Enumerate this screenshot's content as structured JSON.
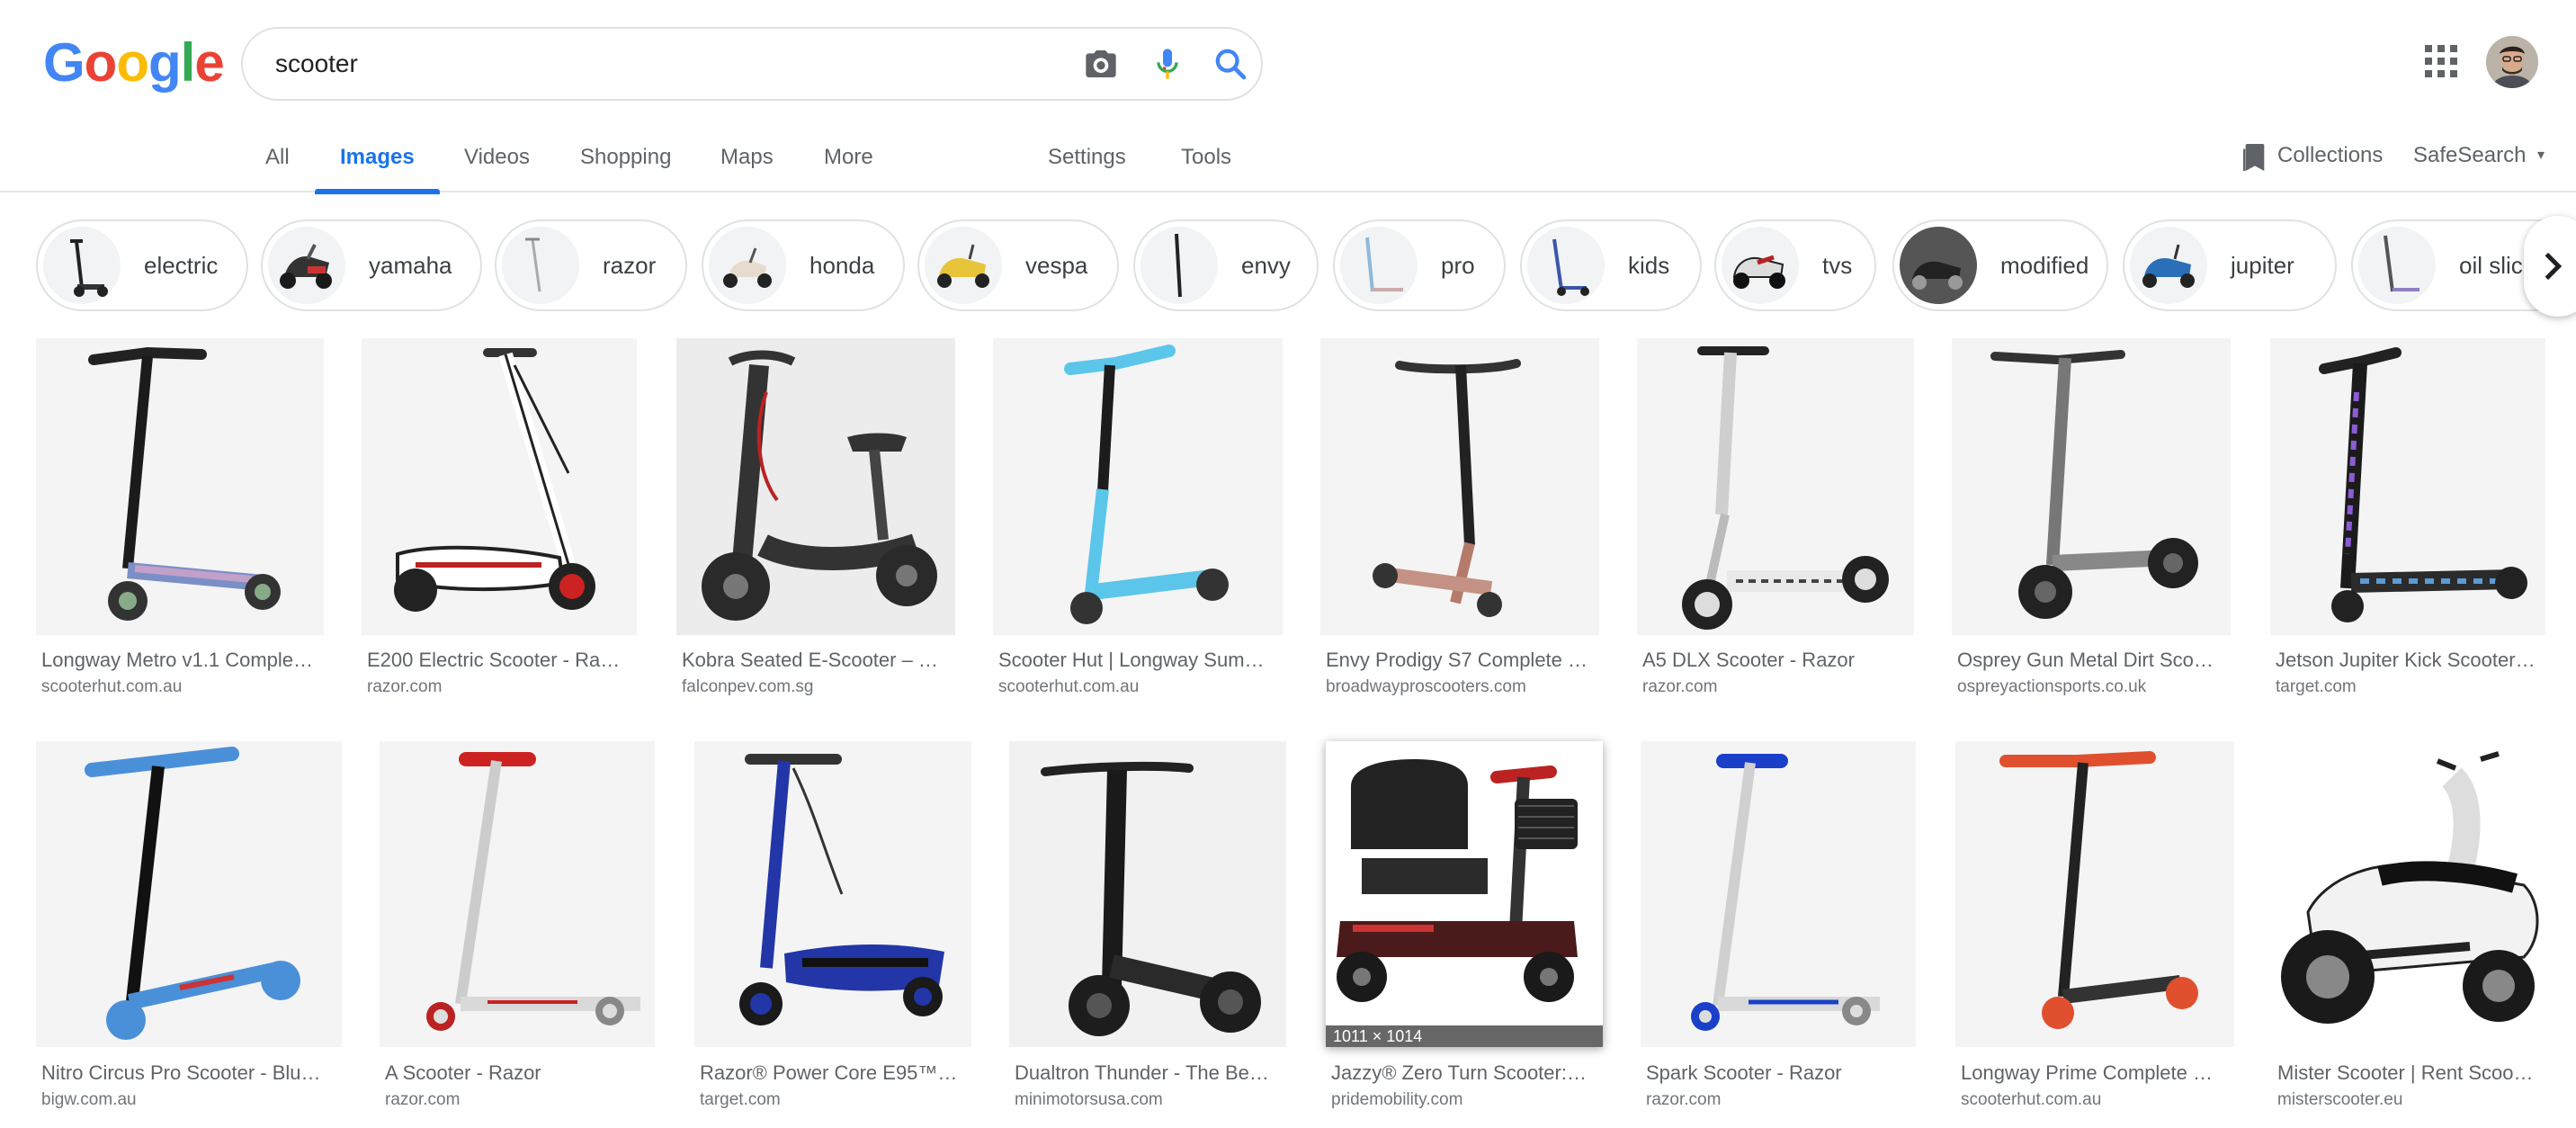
{
  "search": {
    "query": "scooter"
  },
  "logo_letters": [
    {
      "ch": "G",
      "color": "#4285f4"
    },
    {
      "ch": "o",
      "color": "#ea4335"
    },
    {
      "ch": "o",
      "color": "#fbbc05"
    },
    {
      "ch": "g",
      "color": "#4285f4"
    },
    {
      "ch": "l",
      "color": "#34a853"
    },
    {
      "ch": "e",
      "color": "#ea4335"
    }
  ],
  "tabs": [
    {
      "label": "All"
    },
    {
      "label": "Images"
    },
    {
      "label": "Videos"
    },
    {
      "label": "Shopping"
    },
    {
      "label": "Maps"
    },
    {
      "label": "More"
    },
    {
      "label": "Settings"
    },
    {
      "label": "Tools"
    }
  ],
  "right_tools": {
    "collections": "Collections",
    "safesearch": "SafeSearch"
  },
  "chips": [
    {
      "label": "electric"
    },
    {
      "label": "yamaha"
    },
    {
      "label": "razor"
    },
    {
      "label": "honda"
    },
    {
      "label": "vespa"
    },
    {
      "label": "envy"
    },
    {
      "label": "pro"
    },
    {
      "label": "kids"
    },
    {
      "label": "tvs"
    },
    {
      "label": "modified"
    },
    {
      "label": "jupiter"
    },
    {
      "label": "oil slick"
    }
  ],
  "results": [
    {
      "title": "Longway Metro v1.1 Comple…",
      "source": "scooterhut.com.au"
    },
    {
      "title": "E200 Electric Scooter - Ra…",
      "source": "razor.com"
    },
    {
      "title": "Kobra Seated E-Scooter – …",
      "source": "falconpev.com.sg"
    },
    {
      "title": "Scooter Hut | Longway Sum…",
      "source": "scooterhut.com.au"
    },
    {
      "title": "Envy Prodigy S7 Complete …",
      "source": "broadwayproscooters.com"
    },
    {
      "title": "A5 DLX Scooter - Razor",
      "source": "razor.com"
    },
    {
      "title": "Osprey Gun Metal Dirt Sco…",
      "source": "ospreyactionsports.co.uk"
    },
    {
      "title": "Jetson Jupiter Kick Scooter…",
      "source": "target.com"
    },
    {
      "title": "Nitro Circus Pro Scooter - Blu…",
      "source": "bigw.com.au"
    },
    {
      "title": "A Scooter - Razor",
      "source": "razor.com"
    },
    {
      "title": "Razor® Power Core E95™…",
      "source": "target.com"
    },
    {
      "title": "Dualtron Thunder - The Be…",
      "source": "minimotorsusa.com"
    },
    {
      "title": "Jazzy® Zero Turn Scooter:…",
      "source": "pridemobility.com",
      "dims": "1011 × 1014"
    },
    {
      "title": "Spark Scooter - Razor",
      "source": "razor.com"
    },
    {
      "title": "Longway Prime Complete …",
      "source": "scooterhut.com.au"
    },
    {
      "title": "Mister Scooter | Rent Scoo…",
      "source": "misterscooter.eu"
    }
  ]
}
